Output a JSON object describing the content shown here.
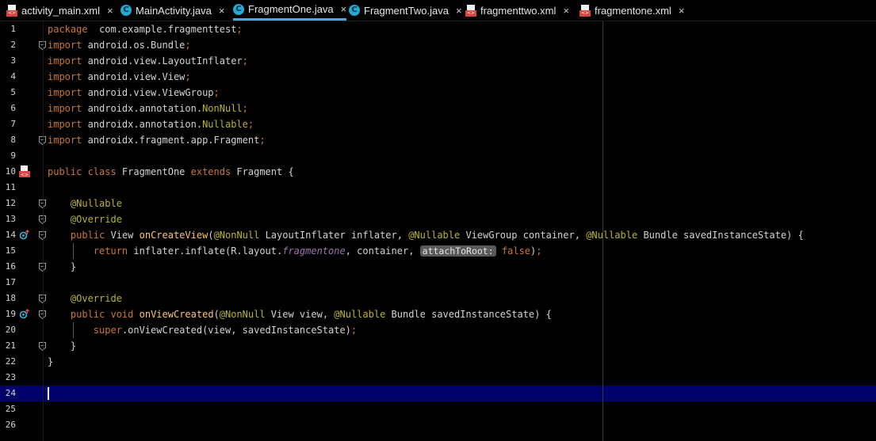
{
  "tabs": [
    {
      "label": "activity_main.xml",
      "icon": "xml-file-icon",
      "active": false
    },
    {
      "label": "MainActivity.java",
      "icon": "java-class-icon",
      "active": false
    },
    {
      "label": "FragmentOne.java",
      "icon": "java-class-icon",
      "active": true
    },
    {
      "label": "FragmentTwo.java",
      "icon": "java-class-icon",
      "active": false
    },
    {
      "label": "fragmenttwo.xml",
      "icon": "xml-file-icon",
      "active": false
    },
    {
      "label": "fragmentone.xml",
      "icon": "xml-file-icon",
      "active": false
    }
  ],
  "close_glyph": "×",
  "editor": {
    "current_line": 24,
    "lines": [
      {
        "n": "1",
        "segs": [
          [
            "kw",
            "package"
          ],
          [
            "",
            "  com.example.fragmenttest"
          ],
          [
            "kw",
            ";"
          ]
        ]
      },
      {
        "n": "2",
        "segs": [
          [
            "kw",
            "import"
          ],
          [
            "",
            " android.os.Bundle"
          ],
          [
            "kw",
            ";"
          ]
        ]
      },
      {
        "n": "3",
        "segs": [
          [
            "kw",
            "import"
          ],
          [
            "",
            " android.view.LayoutInflater"
          ],
          [
            "kw",
            ";"
          ]
        ]
      },
      {
        "n": "4",
        "segs": [
          [
            "kw",
            "import"
          ],
          [
            "",
            " android.view.View"
          ],
          [
            "kw",
            ";"
          ]
        ]
      },
      {
        "n": "5",
        "segs": [
          [
            "kw",
            "import"
          ],
          [
            "",
            " android.view.ViewGroup"
          ],
          [
            "kw",
            ";"
          ]
        ]
      },
      {
        "n": "6",
        "segs": [
          [
            "kw",
            "import"
          ],
          [
            "",
            " androidx.annotation."
          ],
          [
            "ann",
            "NonNull"
          ],
          [
            "kw",
            ";"
          ]
        ]
      },
      {
        "n": "7",
        "segs": [
          [
            "kw",
            "import"
          ],
          [
            "",
            " androidx.annotation."
          ],
          [
            "ann",
            "Nullable"
          ],
          [
            "kw",
            ";"
          ]
        ]
      },
      {
        "n": "8",
        "segs": [
          [
            "kw",
            "import"
          ],
          [
            "",
            " androidx.fragment.app.Fragment"
          ],
          [
            "kw",
            ";"
          ]
        ]
      },
      {
        "n": "9",
        "segs": []
      },
      {
        "n": "10",
        "segs": [
          [
            "kw",
            "public class"
          ],
          [
            "",
            " FragmentOne "
          ],
          [
            "kw",
            "extends"
          ],
          [
            "",
            " Fragment {"
          ]
        ]
      },
      {
        "n": "11",
        "segs": []
      },
      {
        "n": "12",
        "segs": [
          [
            "",
            "    "
          ],
          [
            "ann",
            "@Nullable"
          ]
        ]
      },
      {
        "n": "13",
        "segs": [
          [
            "",
            "    "
          ],
          [
            "ann",
            "@Override"
          ]
        ]
      },
      {
        "n": "14",
        "segs": [
          [
            "",
            "    "
          ],
          [
            "kw",
            "public"
          ],
          [
            "",
            " View "
          ],
          [
            "fn",
            "onCreateView"
          ],
          [
            "",
            "("
          ],
          [
            "ann",
            "@NonNull"
          ],
          [
            "",
            " LayoutInflater inflater, "
          ],
          [
            "ann",
            "@Nullable"
          ],
          [
            "",
            " ViewGroup container, "
          ],
          [
            "ann",
            "@Nullable"
          ],
          [
            "",
            " Bundle savedInstanceState) {"
          ]
        ]
      },
      {
        "n": "15",
        "segs": [
          [
            "",
            "        "
          ],
          [
            "kw",
            "return"
          ],
          [
            "",
            " inflater.inflate(R.layout."
          ],
          [
            "ital",
            "fragmentone"
          ],
          [
            "",
            ", container, "
          ],
          [
            "hint",
            "attachToRoot:"
          ],
          [
            "",
            " "
          ],
          [
            "kw",
            "false"
          ],
          [
            "",
            ")"
          ],
          [
            "kw",
            ";"
          ]
        ]
      },
      {
        "n": "16",
        "segs": [
          [
            "",
            "    }"
          ]
        ]
      },
      {
        "n": "17",
        "segs": []
      },
      {
        "n": "18",
        "segs": [
          [
            "",
            "    "
          ],
          [
            "ann",
            "@Override"
          ]
        ]
      },
      {
        "n": "19",
        "segs": [
          [
            "",
            "    "
          ],
          [
            "kw",
            "public void"
          ],
          [
            "",
            " "
          ],
          [
            "fn",
            "onViewCreated"
          ],
          [
            "",
            "("
          ],
          [
            "ann",
            "@NonNull"
          ],
          [
            "",
            " View view, "
          ],
          [
            "ann",
            "@Nullable"
          ],
          [
            "",
            " Bundle savedInstanceState) {"
          ]
        ]
      },
      {
        "n": "20",
        "segs": [
          [
            "",
            "        "
          ],
          [
            "kw",
            "super"
          ],
          [
            "",
            ".onViewCreated(view, savedInstanceState)"
          ],
          [
            "kw",
            ";"
          ]
        ]
      },
      {
        "n": "21",
        "segs": [
          [
            "",
            "    }"
          ]
        ]
      },
      {
        "n": "22",
        "segs": [
          [
            "",
            "}"
          ]
        ]
      },
      {
        "n": "23",
        "segs": []
      },
      {
        "n": "24",
        "segs": []
      },
      {
        "n": "25",
        "segs": []
      },
      {
        "n": "26",
        "segs": []
      }
    ]
  },
  "gutter_icons": [
    {
      "line": 10,
      "icon": "xml-layout-icon"
    },
    {
      "line": 14,
      "icon": "override-method-icon"
    },
    {
      "line": 19,
      "icon": "override-method-icon"
    }
  ],
  "fold_markers": [
    2,
    8,
    12,
    13,
    14,
    16,
    18,
    19,
    21
  ],
  "colors": {
    "background": "#000000",
    "current_line": "#00006b",
    "keyword": "#cc7832",
    "annotation": "#bbb529",
    "method": "#ffc66d",
    "field": "#9876aa",
    "tab_underline": "#4ea9d6"
  }
}
